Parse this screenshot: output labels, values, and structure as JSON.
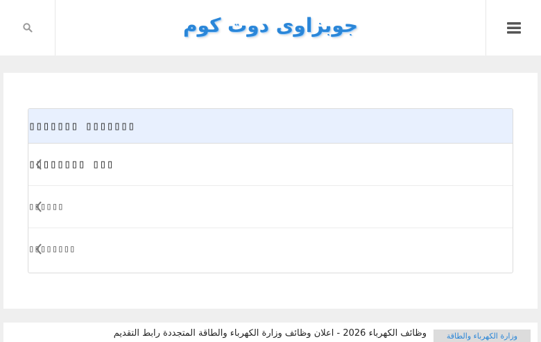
{
  "header": {
    "logo_text": "جوبزاوى دوت كوم",
    "search_icon": "search-icon",
    "menu_icon": "hamburger-menu-icon",
    "accent_color": "#2a86d8"
  },
  "card": {
    "title": "▯▯▯▯▯▯▯ ▯▯▯▯▯▯▯",
    "rows": [
      {
        "label": "▯▯▯ ▯▯▯▯▯▯▯▯",
        "icon": "chevron-left-icon"
      },
      {
        "label": "▯▯▯▯▯▯",
        "icon": "chevron-left-icon"
      },
      {
        "label": "▯▯▯▯▯▯▯▯",
        "icon": "chevron-left-icon"
      }
    ]
  },
  "ticker": {
    "tag": "وزارة الكهرباء والطاقة",
    "headline": "وظائف الكهرباء 2026 - اعلان وظائف وزارة الكهرباء والطاقة المتجددة رابط التقديم"
  }
}
